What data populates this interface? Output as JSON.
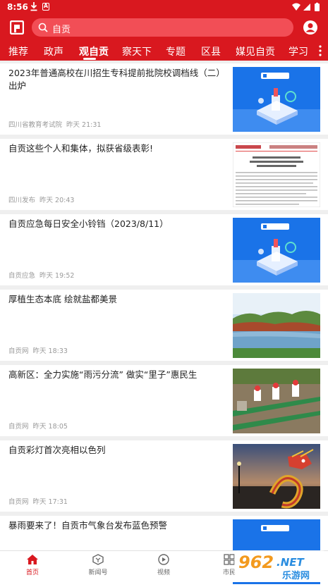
{
  "status": {
    "time": "8:56",
    "a_label": "A"
  },
  "search": {
    "value": "自贡"
  },
  "tabs": [
    {
      "label": "推荐"
    },
    {
      "label": "政声"
    },
    {
      "label": "观自贡"
    },
    {
      "label": "察天下"
    },
    {
      "label": "专题"
    },
    {
      "label": "区县"
    },
    {
      "label": "媒见自贡"
    },
    {
      "label": "学习"
    }
  ],
  "active_tab_index": 2,
  "articles": [
    {
      "title": "2023年普通高校在川招生专科提前批院校调档线（二）出炉",
      "source": "四川省教育考试院",
      "time": "昨天 21:31",
      "thumb": "blue-logo-graphic"
    },
    {
      "title": "自贡这些个人和集体，拟获省级表彰!",
      "source": "四川发布",
      "time": "昨天 20:43",
      "thumb": "document-screenshot"
    },
    {
      "title": "自贡应急每日安全小铃铛（2023/8/11）",
      "source": "自贡应急",
      "time": "昨天 19:52",
      "thumb": "blue-logo-graphic"
    },
    {
      "title": "厚植生态本底 绘就盐都美景",
      "source": "自贡网",
      "time": "昨天 18:33",
      "thumb": "lake-photo"
    },
    {
      "title": "高新区：全力实施“雨污分流” 做实“里子”惠民生",
      "source": "自贡网",
      "time": "昨天 18:05",
      "thumb": "construction-photo"
    },
    {
      "title": "自贡彩灯首次亮相以色列",
      "source": "自贡网",
      "time": "昨天 17:31",
      "thumb": "dragon-lantern-photo"
    },
    {
      "title": "暴雨要来了！自贡市气象台发布蓝色预警",
      "source": "",
      "time": "",
      "thumb": "blue-logo-graphic"
    }
  ],
  "bottom_nav": [
    {
      "label": "首页",
      "icon": "home-icon"
    },
    {
      "label": "新闻号",
      "icon": "hexagon-icon"
    },
    {
      "label": "视频",
      "icon": "play-icon"
    },
    {
      "label": "市民",
      "icon": "grid-icon"
    }
  ],
  "colors": {
    "brand_red": "#d9181f",
    "thumb_blue": "#1a73e8"
  },
  "watermark": {
    "text": "962",
    "subtext": "乐游网",
    "suffix": ".NET"
  }
}
